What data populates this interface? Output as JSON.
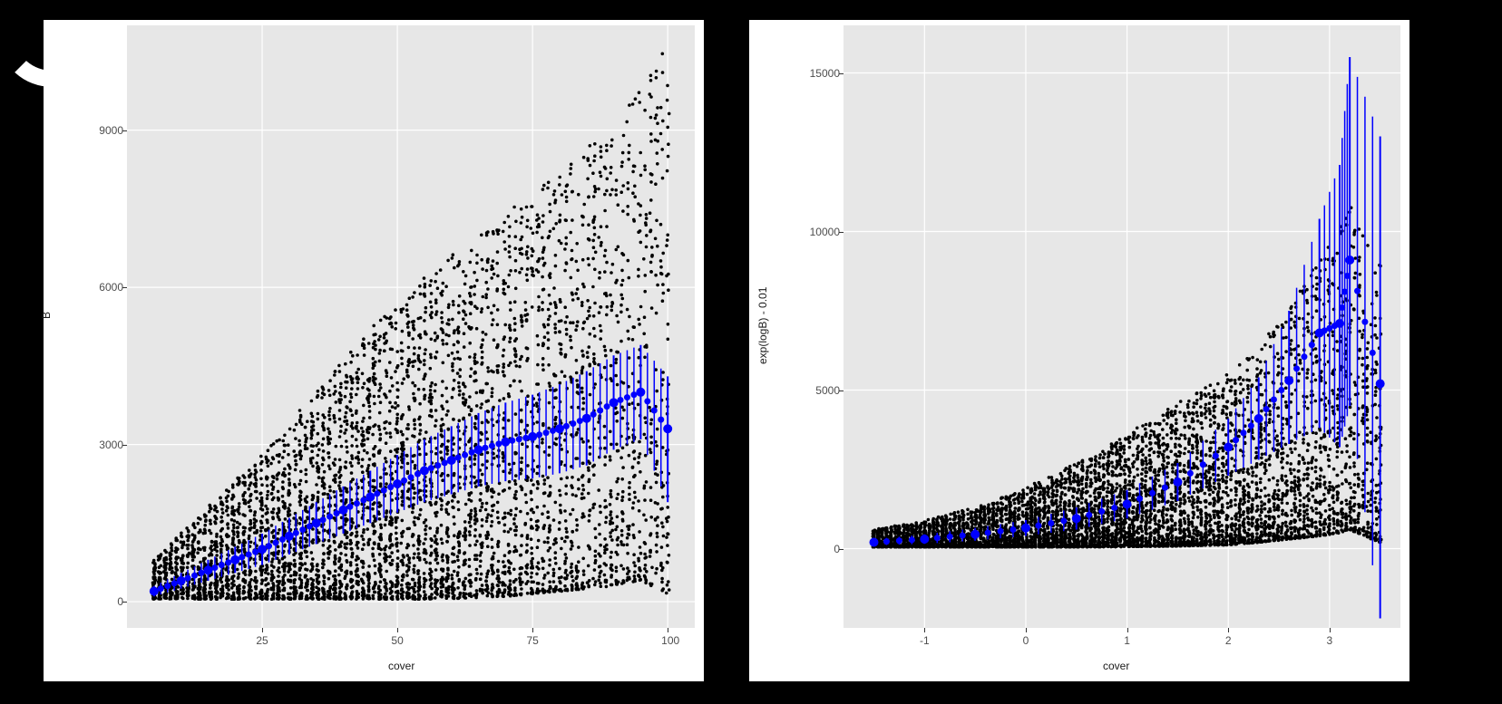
{
  "chart_data": [
    {
      "type": "scatter",
      "title": "",
      "xlabel": "cover",
      "ylabel": "B",
      "xlim": [
        0,
        105
      ],
      "ylim": [
        -500,
        11000
      ],
      "xticks": [
        25,
        50,
        75,
        100
      ],
      "yticks": [
        0,
        3000,
        6000,
        9000
      ],
      "scatter_description": "dense cloud of black points; for each integer cover value a vertical column of points fans out, spread in B increases with cover",
      "summary_series": {
        "description": "blue summary points with vertical error bars (approx mean ± CI per cover value)",
        "x": [
          5,
          10,
          15,
          20,
          25,
          30,
          35,
          40,
          45,
          50,
          55,
          60,
          65,
          70,
          75,
          80,
          85,
          90,
          95,
          100
        ],
        "mean": [
          200,
          400,
          600,
          800,
          1000,
          1250,
          1500,
          1750,
          2000,
          2250,
          2500,
          2700,
          2900,
          3050,
          3150,
          3300,
          3500,
          3800,
          4000,
          3300
        ],
        "lower": [
          100,
          250,
          400,
          550,
          700,
          900,
          1100,
          1300,
          1500,
          1700,
          1900,
          2050,
          2200,
          2300,
          2350,
          2450,
          2600,
          2900,
          3100,
          1900
        ],
        "upper": [
          300,
          550,
          800,
          1050,
          1300,
          1600,
          1900,
          2200,
          2500,
          2800,
          3100,
          3350,
          3600,
          3800,
          3950,
          4150,
          4400,
          4700,
          4900,
          4300
        ]
      },
      "scatter_envelope": {
        "x": [
          5,
          10,
          15,
          20,
          25,
          30,
          35,
          40,
          45,
          50,
          55,
          60,
          65,
          70,
          75,
          80,
          85,
          90,
          95,
          100
        ],
        "ymin": [
          50,
          50,
          50,
          50,
          50,
          50,
          50,
          50,
          50,
          50,
          50,
          60,
          80,
          100,
          150,
          200,
          250,
          300,
          400,
          150
        ],
        "ymax": [
          800,
          1300,
          1800,
          2300,
          2800,
          3400,
          4000,
          4600,
          5200,
          5700,
          6200,
          6600,
          7000,
          7400,
          7800,
          8200,
          8700,
          9200,
          9800,
          10800
        ]
      }
    },
    {
      "type": "scatter",
      "title": "",
      "xlabel": "cover",
      "ylabel": "exp(logB) - 0.01",
      "xlim": [
        -1.8,
        3.7
      ],
      "ylim": [
        -2500,
        16500
      ],
      "xticks": [
        -1,
        0,
        1,
        2,
        3
      ],
      "yticks": [
        0,
        5000,
        10000,
        15000
      ],
      "scatter_description": "dense black points on transformed x-axis; variance in y grows sharply for x>2",
      "summary_series": {
        "description": "blue summary points with vertical error bars, curve rises exponentially",
        "x": [
          -1.5,
          -1.0,
          -0.5,
          0.0,
          0.5,
          1.0,
          1.5,
          2.0,
          2.3,
          2.6,
          2.9,
          3.1,
          3.2,
          3.5
        ],
        "mean": [
          200,
          300,
          450,
          650,
          950,
          1400,
          2100,
          3200,
          4100,
          5300,
          6800,
          7100,
          9100,
          5200
        ],
        "lower": [
          100,
          150,
          250,
          400,
          600,
          950,
          1500,
          2300,
          2800,
          3300,
          3800,
          3200,
          4500,
          -2200
        ],
        "upper": [
          300,
          450,
          650,
          900,
          1300,
          1850,
          2700,
          4100,
          5400,
          7500,
          10400,
          12100,
          15500,
          13000
        ]
      },
      "scatter_envelope": {
        "x": [
          -1.5,
          -1.0,
          -0.5,
          0.0,
          0.5,
          1.0,
          1.5,
          2.0,
          2.3,
          2.6,
          2.9,
          3.1,
          3.2,
          3.5
        ],
        "ymin": [
          50,
          50,
          50,
          50,
          50,
          60,
          80,
          120,
          200,
          300,
          400,
          500,
          600,
          200
        ],
        "ymax": [
          600,
          900,
          1300,
          1900,
          2700,
          3600,
          4600,
          5600,
          6400,
          7600,
          9200,
          10000,
          10800,
          9200
        ]
      }
    }
  ],
  "left": {
    "xlabel": "cover",
    "ylabel": "B",
    "xticks": [
      "25",
      "50",
      "75",
      "100"
    ],
    "yticks": [
      "0",
      "3000",
      "6000",
      "9000"
    ]
  },
  "right": {
    "xlabel": "cover",
    "ylabel": "exp(logB) - 0.01",
    "xticks": [
      "-1",
      "0",
      "1",
      "2",
      "3"
    ],
    "yticks": [
      "0",
      "5000",
      "10000",
      "15000"
    ]
  },
  "colors": {
    "point": "#000000",
    "summary": "#0000ff",
    "panel": "#e7e7e7",
    "grid_major": "#ffffff"
  }
}
